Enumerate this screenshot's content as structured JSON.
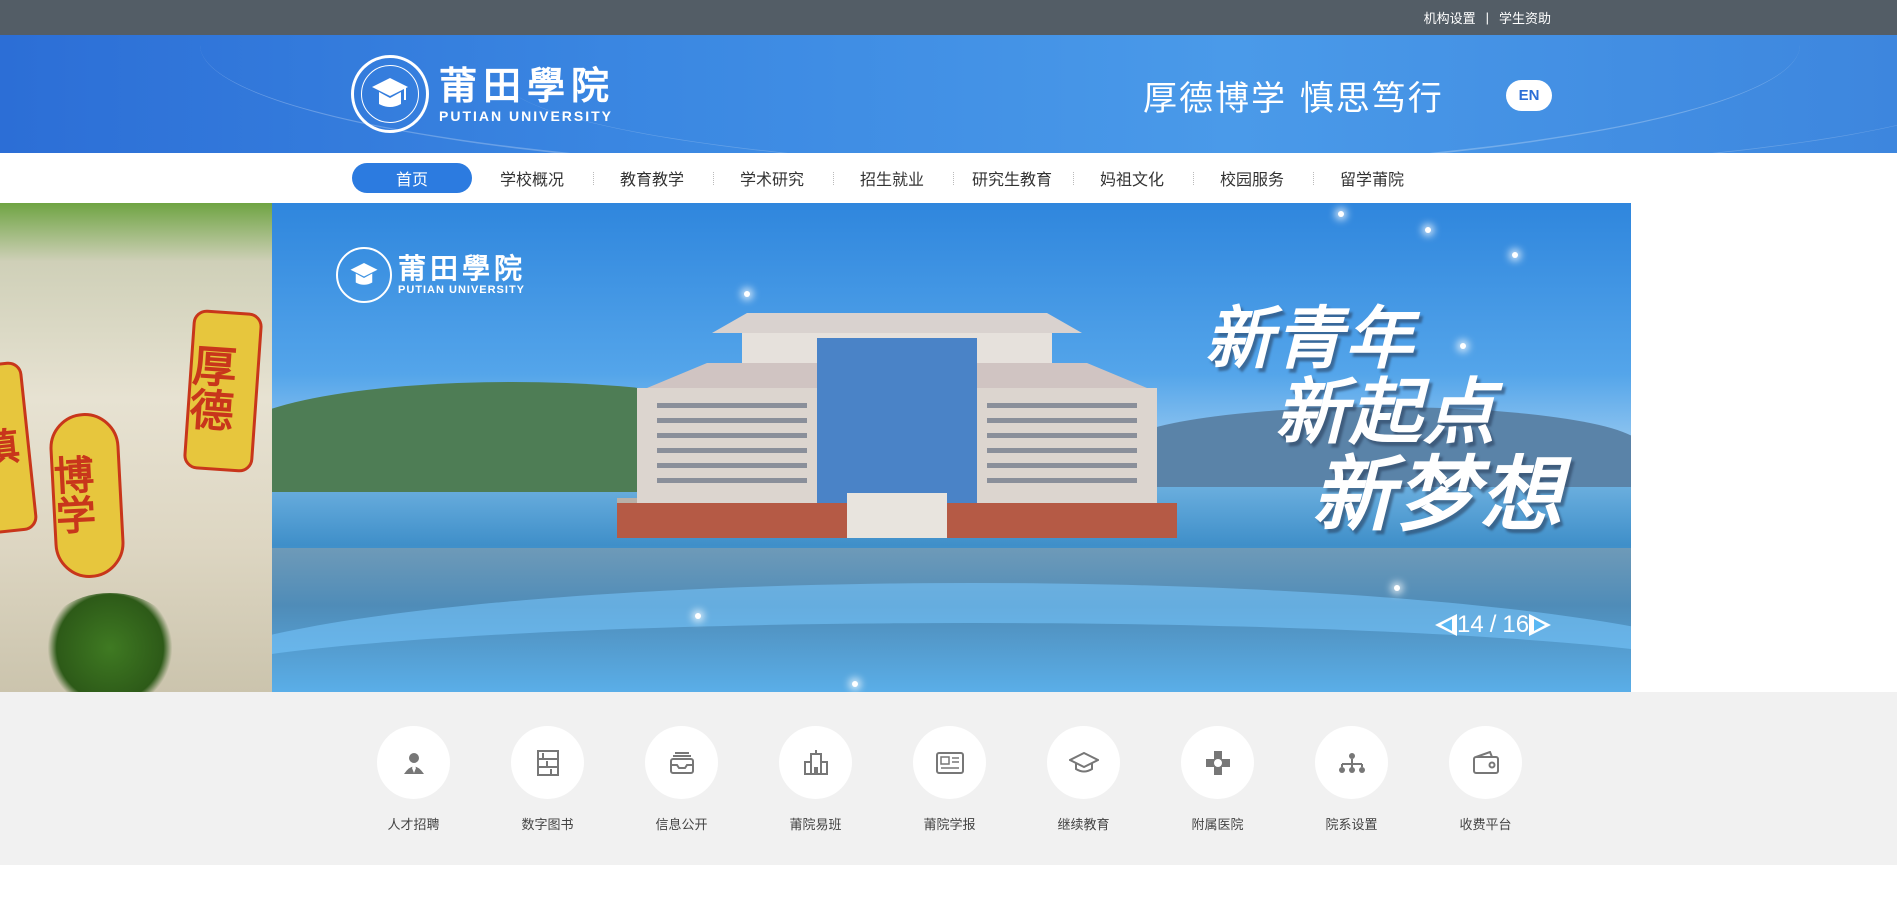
{
  "topbar": {
    "links": [
      {
        "label": "机构设置"
      },
      {
        "label": "学生资助"
      }
    ],
    "separator": "|"
  },
  "header": {
    "logo_cn": "莆田學院",
    "logo_en": "PUTIAN   UNIVERSITY",
    "motto": "厚德博学  慎思笃行",
    "lang_button": "EN",
    "colors": {
      "header_bg": "#3b88e2",
      "accent": "#2c7be0"
    }
  },
  "nav": {
    "items": [
      {
        "label": "首页",
        "active": true
      },
      {
        "label": "学校概况"
      },
      {
        "label": "教育教学"
      },
      {
        "label": "学术研究"
      },
      {
        "label": "招生就业"
      },
      {
        "label": "研究生教育"
      },
      {
        "label": "妈祖文化"
      },
      {
        "label": "校园服务"
      },
      {
        "label": "留学莆院"
      }
    ]
  },
  "banner": {
    "logo_cn": "莆田學院",
    "logo_en": "PUTIAN   UNIVERSITY",
    "slogan": [
      "新青年",
      "新起点",
      "新梦想"
    ],
    "stamps": [
      "厚德",
      "博学",
      "慎"
    ],
    "current": "14",
    "separator": "/",
    "total": "16"
  },
  "quick_links": [
    {
      "label": "人才招聘",
      "icon": "person-icon"
    },
    {
      "label": "数字图书",
      "icon": "bookshelf-icon"
    },
    {
      "label": "信息公开",
      "icon": "inbox-icon"
    },
    {
      "label": "莆院易班",
      "icon": "building-icon"
    },
    {
      "label": "莆院学报",
      "icon": "newspaper-icon"
    },
    {
      "label": "继续教育",
      "icon": "graduation-cap-icon"
    },
    {
      "label": "附属医院",
      "icon": "hospital-cross-icon"
    },
    {
      "label": "院系设置",
      "icon": "org-chart-icon"
    },
    {
      "label": "收费平台",
      "icon": "wallet-icon"
    }
  ]
}
